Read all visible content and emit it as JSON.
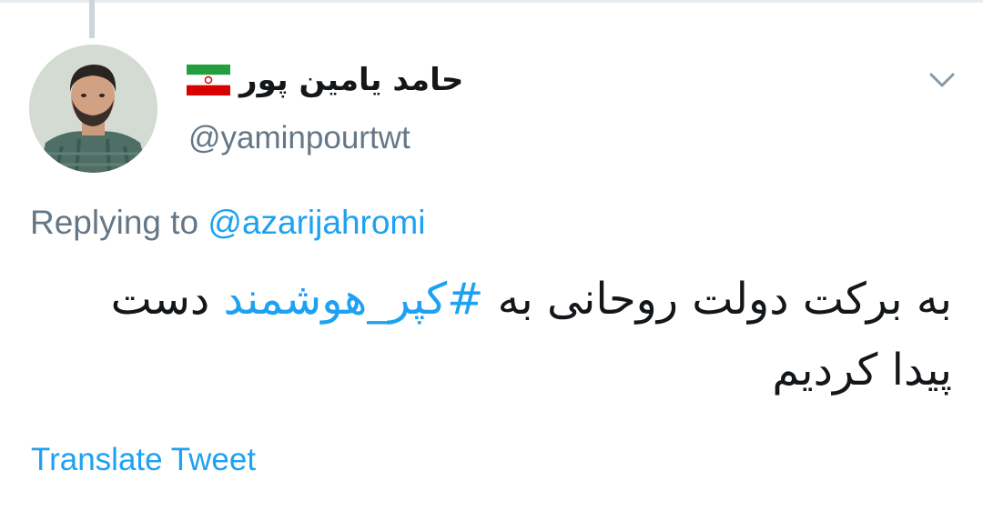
{
  "tweet": {
    "author": {
      "display_name": "حامد یامین پور",
      "flag_icon": "iran-flag-icon",
      "handle": "@yaminpourtwt"
    },
    "replying_prefix": "Replying to",
    "replying_to": "@azarijahromi",
    "text_part1": "به برکت دولت روحانی به ",
    "hashtag": "#کپر_هوشمند",
    "text_part2": " دست پیدا کردیم",
    "translate_label": "Translate Tweet",
    "menu_icon": "chevron-down-icon"
  },
  "colors": {
    "link": "#1da1f2",
    "secondary_text": "#657786",
    "primary_text": "#14171a",
    "flag_green": "#239f40",
    "flag_red": "#da0000"
  }
}
